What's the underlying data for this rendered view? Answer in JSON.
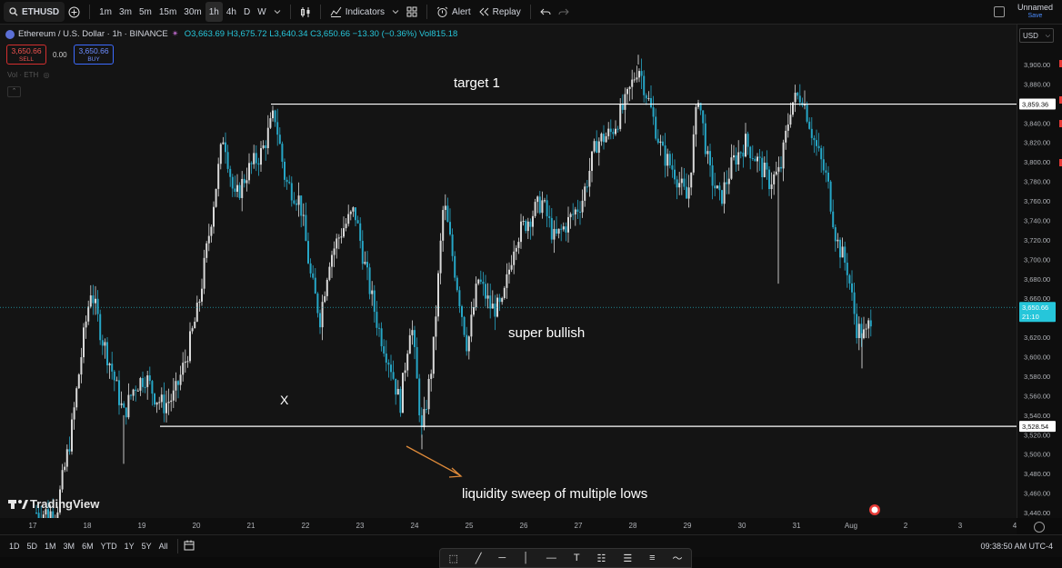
{
  "toolbar": {
    "symbol": "ETHUSD",
    "timeframes": [
      "1m",
      "3m",
      "5m",
      "15m",
      "30m",
      "1h",
      "4h",
      "D",
      "W"
    ],
    "active_timeframe": "1h",
    "indicators_label": "Indicators",
    "alert_label": "Alert",
    "replay_label": "Replay",
    "layout_name": "Unnamed",
    "save_label": "Save"
  },
  "legend": {
    "title": "Ethereum / U.S. Dollar · 1h · BINANCE",
    "open_label": "O",
    "open": "3,663.69",
    "high_label": "H",
    "high": "3,675.72",
    "low_label": "L",
    "low": "3,640.34",
    "close_label": "C",
    "close": "3,650.66",
    "change": "−13.30 (−0.36%)",
    "vol_label": "Vol",
    "vol_value": "815.18",
    "sell_price": "3,650.66",
    "sell_label": "SELL",
    "buy_price": "3,650.66",
    "buy_label": "BUY",
    "spread": "0.00",
    "vol_line": "Vol · ETH"
  },
  "currency": "USD",
  "price_axis": {
    "ticks": [
      "3,900.00",
      "3,880.00",
      "3,860.00",
      "3,840.00",
      "3,820.00",
      "3,800.00",
      "3,780.00",
      "3,760.00",
      "3,740.00",
      "3,720.00",
      "3,700.00",
      "3,680.00",
      "3,660.00",
      "3,640.00",
      "3,620.00",
      "3,600.00",
      "3,580.00",
      "3,560.00",
      "3,540.00",
      "3,520.00",
      "3,500.00",
      "3,480.00",
      "3,460.00",
      "3,440.00"
    ],
    "line_labels": [
      "3,859.36",
      "3,528.54"
    ],
    "current_price": "3,650.66",
    "countdown": "21:10"
  },
  "time_axis": [
    "17",
    "18",
    "19",
    "20",
    "21",
    "22",
    "23",
    "24",
    "25",
    "26",
    "27",
    "28",
    "29",
    "30",
    "31",
    "Aug",
    "2",
    "3",
    "4"
  ],
  "annotations": {
    "target": "target 1",
    "bullish": "super bullish",
    "x_mark": "X",
    "sweep": "liquidity sweep of multiple lows"
  },
  "watermark": "TradingView",
  "ranges": [
    "1D",
    "5D",
    "1M",
    "3M",
    "6M",
    "YTD",
    "1Y",
    "5Y",
    "All"
  ],
  "clock": "09:38:50 AM UTC-4",
  "colors": {
    "up": "#d9d9d9",
    "down": "#26a6c6",
    "background": "#141414",
    "accent": "#2962ff"
  },
  "chart_data": {
    "type": "candlestick",
    "x": [
      "17",
      "18",
      "19",
      "20",
      "21",
      "22",
      "23",
      "24",
      "25",
      "26",
      "27",
      "28",
      "29",
      "30",
      "31",
      "Aug",
      "2",
      "3",
      "4"
    ],
    "ylim": [
      3440,
      3910
    ],
    "horizontal_levels": [
      {
        "label": "target 1",
        "value": 3859.36
      },
      {
        "label": "liquidity sweep of multiple lows",
        "value": 3528.54
      }
    ],
    "last_price": 3650.66
  }
}
